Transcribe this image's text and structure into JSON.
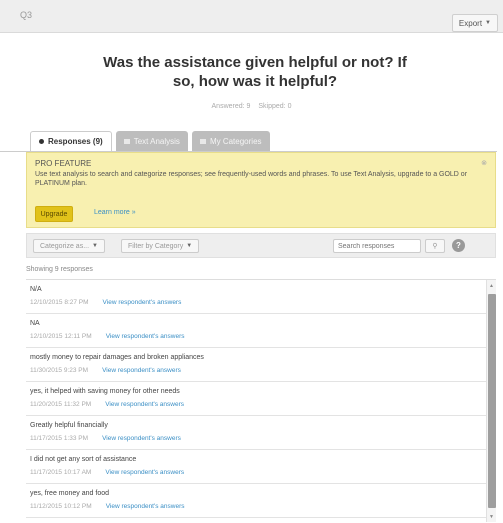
{
  "header": {
    "question_id": "Q3",
    "export_label": "Export"
  },
  "question": {
    "title": "Was the assistance given helpful or not? If so, how was it helpful?",
    "answered": "Answered: 9",
    "skipped": "Skipped: 0"
  },
  "tabs": [
    {
      "label": "Responses (9)"
    },
    {
      "label": "Text Analysis"
    },
    {
      "label": "My Categories"
    }
  ],
  "pro_feature": {
    "title": "PRO FEATURE",
    "text": "Use text analysis to search and categorize responses; see frequently-used words and phrases. To use Text Analysis, upgrade to a GOLD or PLATINUM plan.",
    "upgrade_label": "Upgrade",
    "learn_more_label": "Learn more »"
  },
  "filters": {
    "categorize_label": "Categorize as...",
    "filter_label": "Filter by Category",
    "search_placeholder": "Search responses"
  },
  "showing_text": "Showing 9 responses",
  "responses": [
    {
      "text": "N/A",
      "date": "12/10/2015 8:27 PM",
      "link": "View respondent's answers"
    },
    {
      "text": "NA",
      "date": "12/10/2015 12:11 PM",
      "link": "View respondent's answers"
    },
    {
      "text": "mostly money to repair damages and broken appliances",
      "date": "11/30/2015 9:23 PM",
      "link": "View respondent's answers"
    },
    {
      "text": "yes, it helped with saving money for other needs",
      "date": "11/20/2015 11:32 PM",
      "link": "View respondent's answers"
    },
    {
      "text": "Greatly helpful financially",
      "date": "11/17/2015 1:33 PM",
      "link": "View respondent's answers"
    },
    {
      "text": "I did not get any sort of assistance",
      "date": "11/17/2015 10:17 AM",
      "link": "View respondent's answers"
    },
    {
      "text": "yes, free money and food",
      "date": "11/12/2015 10:12 PM",
      "link": "View respondent's answers"
    }
  ]
}
